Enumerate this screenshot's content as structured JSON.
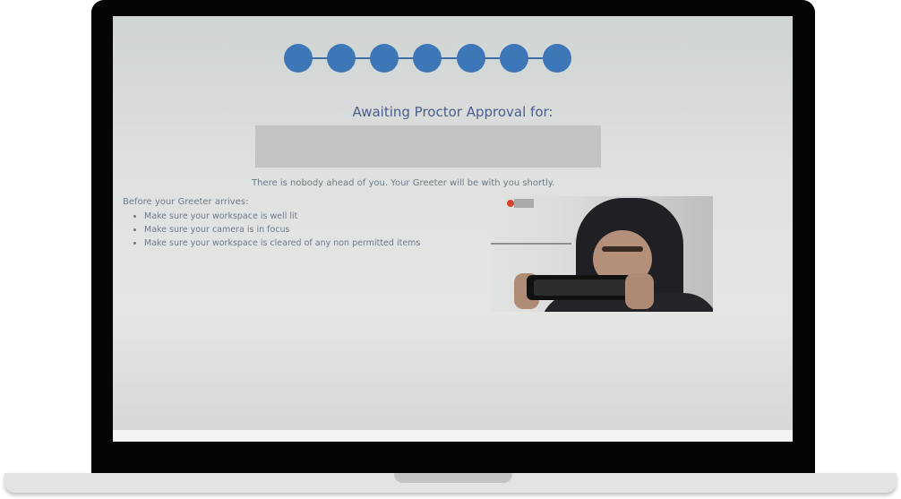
{
  "steps": {
    "count": 7,
    "color": "#3e77b8"
  },
  "approval": {
    "title": "Awaiting Proctor Approval for:",
    "queue_message": "There is nobody ahead of you. Your Greeter will be with you shortly."
  },
  "checklist": {
    "heading": "Before your Greeter arrives:",
    "items": [
      "Make sure your workspace is well lit",
      "Make sure your camera is in focus",
      "Make sure your workspace is cleared of any non permitted items"
    ]
  }
}
